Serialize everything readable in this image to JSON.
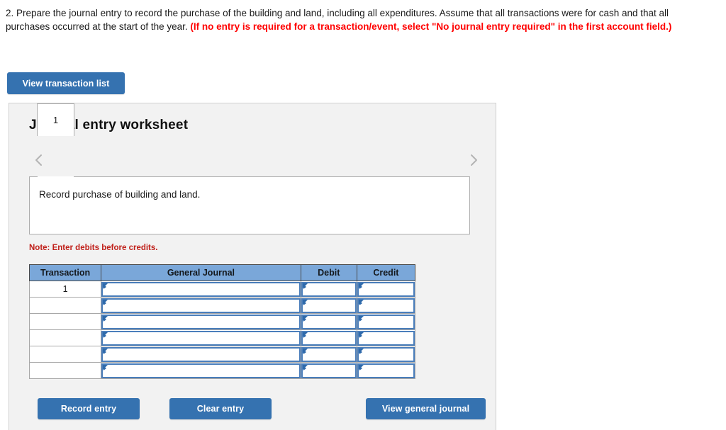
{
  "instructions": {
    "plain_part": "2. Prepare the journal entry to record the purchase of the building and land, including all expenditures. Assume that all transactions were for cash and that all purchases occurred at the start of the year. ",
    "highlight_part": "(If no entry is required for a transaction/event, select \"No journal entry required\" in the first account field.)"
  },
  "toolbar": {
    "view_transaction_list_label": "View transaction list"
  },
  "panel": {
    "title": "Journal entry worksheet",
    "tabs": [
      {
        "label": "1",
        "active": true
      }
    ],
    "prev_arrow_icon": "chevron-left-icon",
    "next_arrow_icon": "chevron-right-icon",
    "description": "Record purchase of building and land.",
    "note": "Note: Enter debits before credits."
  },
  "table": {
    "headers": [
      "Transaction",
      "General Journal",
      "Debit",
      "Credit"
    ],
    "rows": [
      {
        "transaction": "1",
        "general_journal": "",
        "debit": "",
        "credit": ""
      },
      {
        "transaction": "",
        "general_journal": "",
        "debit": "",
        "credit": ""
      },
      {
        "transaction": "",
        "general_journal": "",
        "debit": "",
        "credit": ""
      },
      {
        "transaction": "",
        "general_journal": "",
        "debit": "",
        "credit": ""
      },
      {
        "transaction": "",
        "general_journal": "",
        "debit": "",
        "credit": ""
      },
      {
        "transaction": "",
        "general_journal": "",
        "debit": "",
        "credit": ""
      }
    ]
  },
  "actions": {
    "record_entry_label": "Record entry",
    "clear_entry_label": "Clear entry",
    "view_general_journal_label": "View general journal"
  },
  "colors": {
    "button_blue": "#3572b0",
    "table_header_blue": "#7aa7d9",
    "input_border_blue": "#4a7ebb",
    "instruction_red": "#ff0000",
    "note_red": "#c0201a",
    "panel_background": "#f2f2f2"
  }
}
